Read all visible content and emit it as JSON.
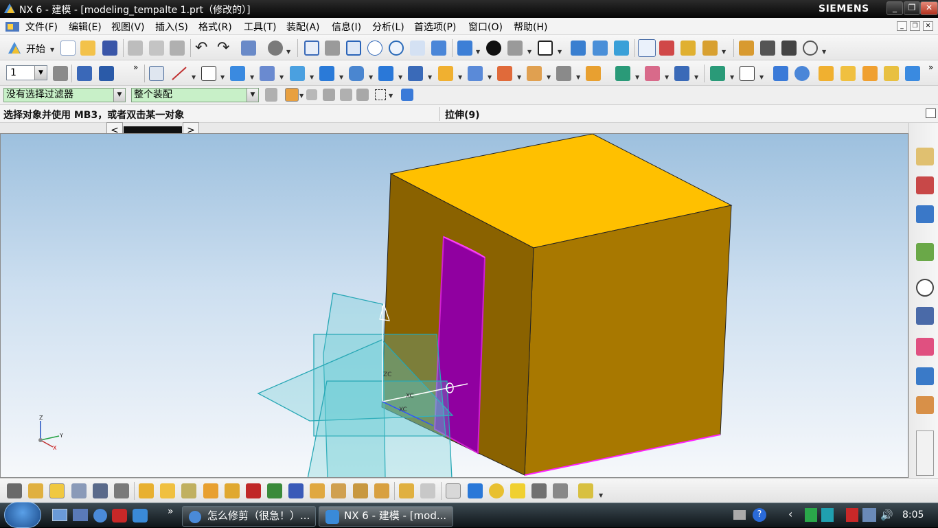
{
  "window": {
    "title": "NX 6 - 建模 - [modeling_tempalte 1.prt（修改的）]",
    "brand": "SIEMENS",
    "minimize": "_",
    "restore": "❐",
    "close": "✕"
  },
  "menubar": {
    "items": [
      {
        "label": "文件(F)"
      },
      {
        "label": "编辑(E)"
      },
      {
        "label": "视图(V)"
      },
      {
        "label": "插入(S)"
      },
      {
        "label": "格式(R)"
      },
      {
        "label": "工具(T)"
      },
      {
        "label": "装配(A)"
      },
      {
        "label": "信息(I)"
      },
      {
        "label": "分析(L)"
      },
      {
        "label": "首选项(P)"
      },
      {
        "label": "窗口(O)"
      },
      {
        "label": "帮助(H)"
      }
    ]
  },
  "toolbar": {
    "start_label": "开始",
    "layer_value": "1"
  },
  "filters": {
    "selection_filter": "没有选择过滤器",
    "scope": "整个装配"
  },
  "cue": {
    "prompt": "选择对象并使用 MB3，或者双击某一对象",
    "status": "拉伸(9)"
  },
  "viewport": {
    "triad_labels": {
      "z": "Z",
      "y": "Y",
      "x": "X"
    },
    "csys_labels": {
      "zc": "ZC",
      "xc1": "XC",
      "xc2": "XC"
    },
    "colors": {
      "box": "#d8a200",
      "top": "#ffc000",
      "cut": "#a000a8",
      "plane": "#39b3c0",
      "edge": "#e020e0"
    }
  },
  "taskbar": {
    "tasks": [
      {
        "label": "怎么修剪（很急！）..."
      },
      {
        "label": "NX 6 - 建模 - [mod..."
      }
    ],
    "clock": "8:05",
    "quicklaunch_more": "»"
  }
}
